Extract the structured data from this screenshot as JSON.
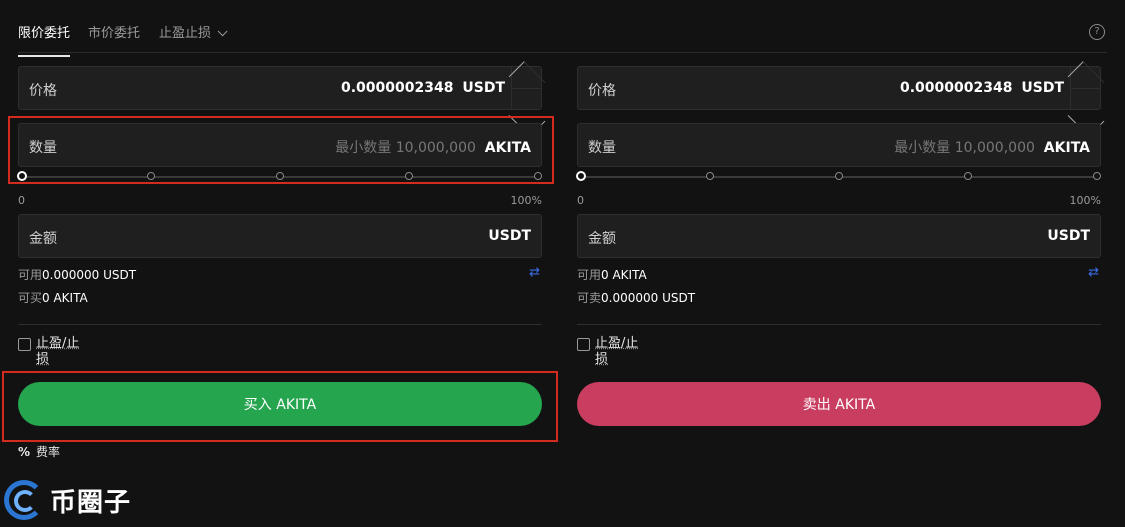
{
  "tabs": [
    {
      "label": "限价委托"
    },
    {
      "label": "市价委托"
    },
    {
      "label": "止盈止损"
    }
  ],
  "help_icon": "?",
  "buy": {
    "price_label": "价格",
    "price_value": "0.0000002348",
    "price_unit": "USDT",
    "qty_label": "数量",
    "qty_placeholder": "最小数量 10,000,000",
    "qty_unit": "AKITA",
    "pct_min": "0",
    "pct_max": "100%",
    "amount_label": "金额",
    "amount_unit": "USDT",
    "avail_label": "可用",
    "avail_value": "0.000000 USDT",
    "can_label": "可买",
    "can_value": "0 AKITA",
    "tp_label": "止盈/止损",
    "button": "买入 AKITA"
  },
  "sell": {
    "price_label": "价格",
    "price_value": "0.0000002348",
    "price_unit": "USDT",
    "qty_label": "数量",
    "qty_placeholder": "最小数量 10,000,000",
    "qty_unit": "AKITA",
    "pct_min": "0",
    "pct_max": "100%",
    "amount_label": "金额",
    "amount_unit": "USDT",
    "avail_label": "可用",
    "avail_value": "0 AKITA",
    "can_label": "可卖",
    "can_value": "0.000000 USDT",
    "tp_label": "止盈/止损",
    "button": "卖出 AKITA"
  },
  "fee": {
    "icon": "%",
    "label": "费率"
  },
  "watermark": "币圈子",
  "colors": {
    "buy": "#24a54e",
    "sell": "#c93d61",
    "highlight": "#d42b1e",
    "swap": "#3b6ee8"
  },
  "icons": {
    "swap": "swap-arrows-icon",
    "help": "help-icon",
    "chevron": "chevron-down-icon"
  }
}
